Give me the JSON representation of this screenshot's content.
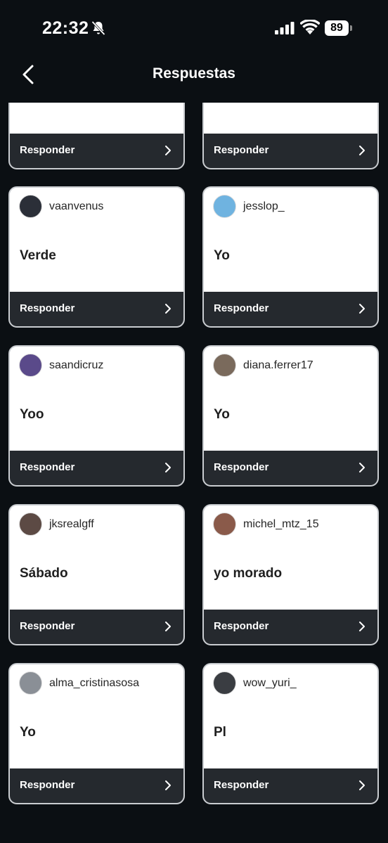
{
  "status_bar": {
    "time": "22:32",
    "battery": "89",
    "icons": [
      "bell-slash-icon",
      "cellular-signal-icon",
      "wifi-icon",
      "battery-icon"
    ]
  },
  "header": {
    "title": "Respuestas",
    "back_icon": "chevron-left-icon"
  },
  "colors": {
    "background": "#0b0f13",
    "card": "#ffffff",
    "respond_bar": "#25292e",
    "card_border": "#c9ccd0"
  },
  "respond_label": "Responder",
  "top_partial": [
    {
      "respond": "Responder"
    },
    {
      "respond": "Responder"
    }
  ],
  "responses": [
    {
      "username": "vaanvenus",
      "answer": "Verde",
      "avatar_color": "#2b2f38"
    },
    {
      "username": "jesslop_",
      "answer": "Yo",
      "avatar_color": "#6fb3e0"
    },
    {
      "username": "saandicruz",
      "answer": "Yoo",
      "avatar_color": "#5a4a8a"
    },
    {
      "username": "diana.ferrer17",
      "answer": "Yo",
      "avatar_color": "#7a6a5c"
    },
    {
      "username": "jksrealgff",
      "answer": "Sábado",
      "avatar_color": "#5c4a44"
    },
    {
      "username": "michel_mtz_15",
      "answer": "yo morado",
      "avatar_color": "#8a5a4a"
    },
    {
      "username": "alma_cristinasosa",
      "answer": "Yo",
      "avatar_color": "#8a8f96"
    },
    {
      "username": "wow_yuri_",
      "answer": "Pl",
      "avatar_color": "#3a3d42"
    }
  ]
}
